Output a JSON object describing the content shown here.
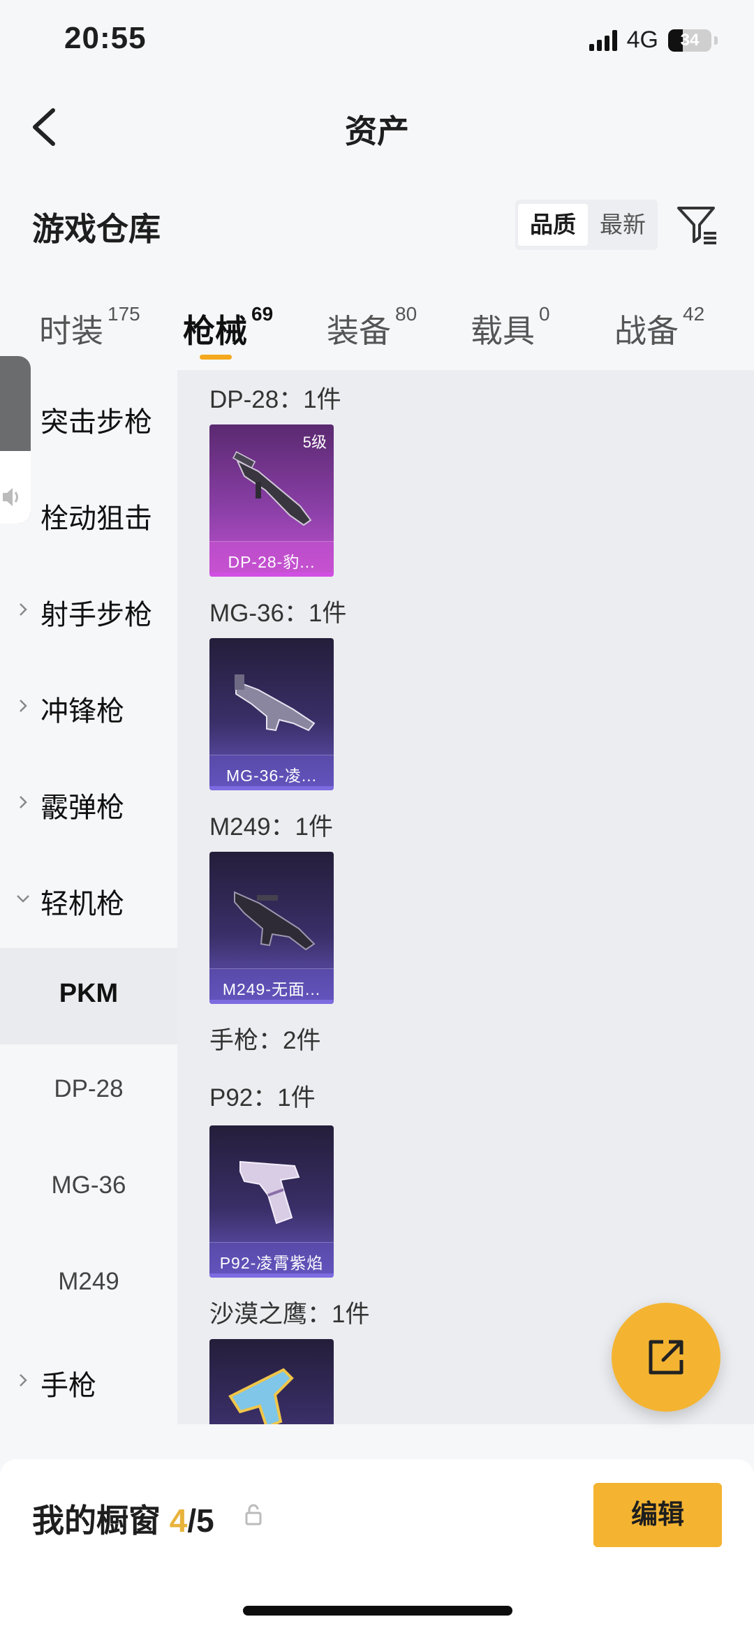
{
  "status_bar": {
    "time": "20:55",
    "network": "4G",
    "battery": "34",
    "battery_level": 0.34
  },
  "nav": {
    "title": "资产"
  },
  "warehouse": {
    "title": "游戏仓库",
    "sort_options": [
      "品质",
      "最新"
    ],
    "active_sort": "品质"
  },
  "tabs": [
    {
      "label": "时装",
      "count": "175"
    },
    {
      "label": "枪械",
      "count": "69"
    },
    {
      "label": "装备",
      "count": "80"
    },
    {
      "label": "载具",
      "count": "0"
    },
    {
      "label": "战备",
      "count": "42"
    }
  ],
  "active_tab": "枪械",
  "sidebar": {
    "categories": [
      "突击步枪",
      "栓动狙击",
      "射手步枪",
      "冲锋枪",
      "霰弹枪",
      "轻机枪"
    ],
    "subcategories": [
      "PKM",
      "DP-28",
      "MG-36",
      "M249"
    ],
    "active_subcategory": "PKM",
    "bottom_category": "手枪"
  },
  "content": {
    "groups": [
      {
        "label": "DP-28：1件",
        "item_name": "DP-28-豹...",
        "level": "5级",
        "quality": "gold"
      },
      {
        "label": "MG-36：1件",
        "item_name": "MG-36-凌...",
        "quality": "purple"
      },
      {
        "label": "M249：1件",
        "item_name": "M249-无面...",
        "quality": "purple"
      },
      {
        "label": "手枪：2件"
      },
      {
        "label": "P92：1件",
        "item_name": "P92-凌霄紫焰",
        "quality": "purple"
      },
      {
        "label": "沙漠之鹰：1件",
        "quality": "purple"
      }
    ]
  },
  "bottom_bar": {
    "showcase_label": "我的橱窗",
    "showcase_count": "4",
    "showcase_total": "/5",
    "edit_label": "编辑"
  },
  "colors": {
    "accent": "#f4b431",
    "tab_indicator": "#f4a81c",
    "count_highlight": "#e8b33b"
  }
}
